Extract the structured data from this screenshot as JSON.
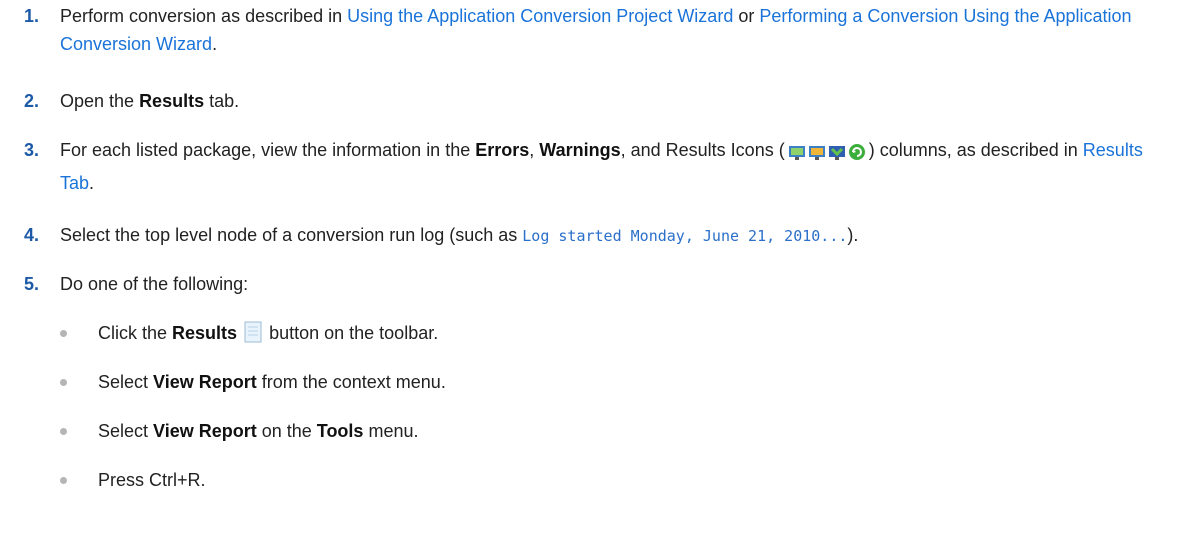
{
  "steps": [
    {
      "num": "1.",
      "t1": "Perform conversion as described in ",
      "link1": "Using the Application Conversion Project Wizard",
      "t2": " or ",
      "link2": "Performing a Conversion Using the Application Conversion Wizard",
      "t3": "."
    },
    {
      "num": "2.",
      "t1": "Open the ",
      "b1": "Results",
      "t2": " tab."
    },
    {
      "num": "3.",
      "t1": "For each listed package, view the information in the ",
      "b1": "Errors",
      "t2": ", ",
      "b2": "Warnings",
      "t3": ", and Results Icons (",
      "t4": ") columns, as described in ",
      "link1": "Results Tab",
      "t5": "."
    },
    {
      "num": "4.",
      "t1": "Select the top level node of a conversion run log (such as ",
      "code": "Log started Monday, June 21, 2010...",
      "t2": ")."
    },
    {
      "num": "5.",
      "t1": "Do one of the following:"
    }
  ],
  "bullets": [
    {
      "t1": "Click the ",
      "b1": "Results",
      "t2": " button on the toolbar.",
      "icon": "report-page-icon"
    },
    {
      "t1": "Select ",
      "b1": "View Report",
      "t2": " from the context menu."
    },
    {
      "t1": "Select ",
      "b1": "View Report",
      "t2": " on the ",
      "b2": "Tools",
      "t3": " menu."
    },
    {
      "t1": "Press Ctrl+R."
    }
  ],
  "icons": [
    "app-converted-icon",
    "app-warning-icon",
    "app-merge-icon",
    "refresh-green-icon"
  ],
  "colors": {
    "link": "#1a73d9",
    "step_number": "#1c5aa8",
    "bullet": "#b5b5b5"
  }
}
